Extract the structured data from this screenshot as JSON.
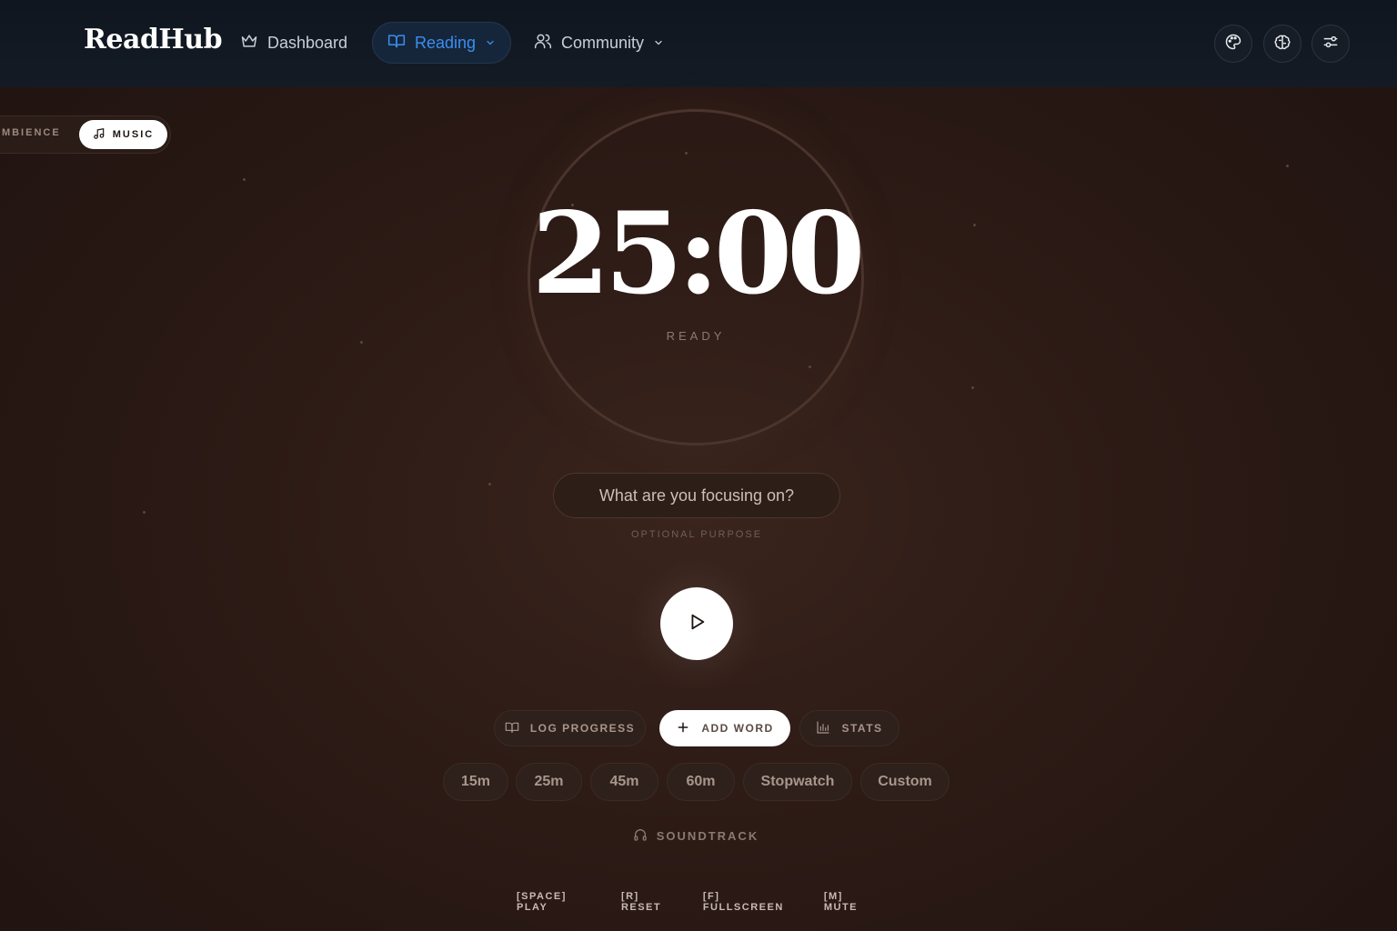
{
  "app": {
    "logo": "ReadHub"
  },
  "nav": {
    "dashboard": "Dashboard",
    "reading": "Reading",
    "community": "Community"
  },
  "mode": {
    "ambience": "AMBIENCE",
    "music": "MUSIC"
  },
  "timer": {
    "time": "25:00",
    "status": "READY"
  },
  "focus": {
    "placeholder": "What are you focusing on?",
    "hint": "OPTIONAL PURPOSE"
  },
  "actions": {
    "log": "LOG PROGRESS",
    "add_word": "ADD WORD",
    "stats": "STATS"
  },
  "presets": [
    "15m",
    "25m",
    "45m",
    "60m",
    "Stopwatch",
    "Custom"
  ],
  "soundtrack": "SOUNDTRACK",
  "shortcuts": [
    "[SPACE] PLAY",
    "[R] RESET",
    "[F] FULLSCREEN",
    "[M] MUTE"
  ],
  "colors": {
    "accent": "#3b8ef0",
    "background": "#2c1a15",
    "header": "#111922"
  }
}
